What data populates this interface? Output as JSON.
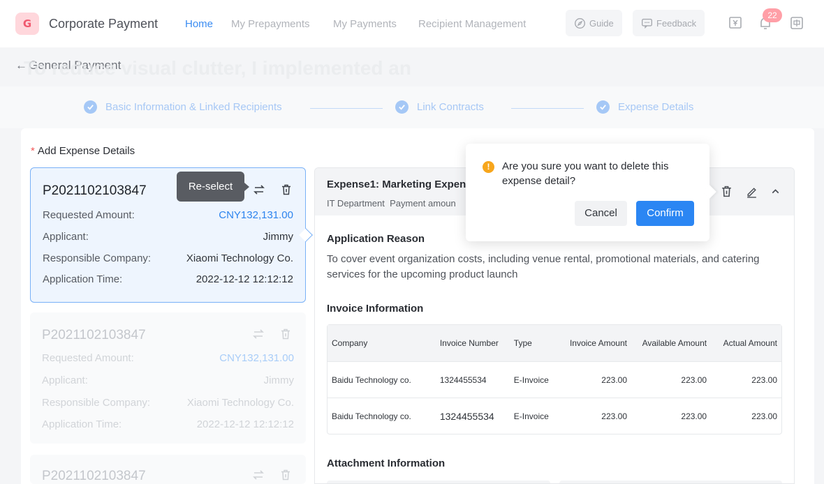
{
  "header": {
    "logo_glyph": "G",
    "title": "Corporate Payment",
    "nav": [
      "Home",
      "My Prepayments",
      "My Payments",
      "Recipient Management"
    ],
    "active_nav": "Home",
    "guide_label": "Guide",
    "feedback_label": "Feedback",
    "notification_count": "22",
    "icons": [
      "wallet-icon",
      "bell-icon",
      "language-icon"
    ]
  },
  "page": {
    "back_title": "General Payment",
    "watermark": "To reduce visual clutter, I implemented an interactive display with collapsible sections"
  },
  "steps": [
    {
      "label": "Basic Information & Linked Recipients",
      "status": "done"
    },
    {
      "label": "Link Contracts",
      "status": "done"
    },
    {
      "label": "Expense Details",
      "status": "done"
    }
  ],
  "section": {
    "required_mark": "*",
    "title": "Add Expense Details"
  },
  "tooltip": "Re-select",
  "cards": [
    {
      "id": "P2021102103847",
      "requested_label": "Requested Amount:",
      "requested": "CNY132,131.00",
      "applicant_label": "Applicant:",
      "applicant": "Jimmy",
      "company_label": "Responsible Company:",
      "company": "Xiaomi Technology Co.",
      "time_label": "Application Time:",
      "time": "2022-12-12 12:12:12"
    },
    {
      "id": "P2021102103847",
      "requested_label": "Requested Amount:",
      "requested": "CNY132,131.00",
      "applicant_label": "Applicant:",
      "applicant": "Jimmy",
      "company_label": "Responsible Company:",
      "company": "Xiaomi Technology Co.",
      "time_label": "Application Time:",
      "time": "2022-12-12 12:12:12"
    },
    {
      "id": "P2021102103847"
    }
  ],
  "expense": {
    "title": "Expense1: Marketing Expen",
    "department": "IT Department",
    "payment_label": "Payment amoun",
    "reason_title": "Application Reason",
    "reason": "To cover event organization costs, including venue rental, promotional materials, and catering services for the upcoming product launch",
    "invoice_title": "Invoice Information",
    "attachment_title": "Attachment Information",
    "invoice_columns": [
      "Company",
      "Invoice Number",
      "Type",
      "Invoice Amount",
      "Available Amount",
      "Actual Amount"
    ],
    "invoices": [
      [
        "Baidu Technology co.",
        "1324455534",
        "E-Invoice",
        "223.00",
        "223.00",
        "223.00"
      ],
      [
        "Baidu Technology co.",
        "1324455534",
        "E-Invoice",
        "223.00",
        "223.00",
        "223.00"
      ]
    ]
  },
  "confirm_dialog": {
    "icon": "!",
    "message": "Are you sure you want to delete this expense detail?",
    "cancel_label": "Cancel",
    "confirm_label": "Confirm"
  },
  "colors": {
    "accent": "#2b86f3",
    "selected_border": "#79b1f7",
    "warning": "#f7a61c",
    "badge": "#ff9fa7"
  }
}
